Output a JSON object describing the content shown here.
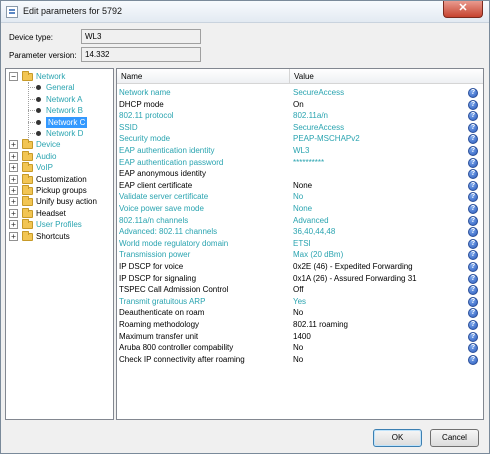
{
  "window": {
    "title": "Edit parameters for 5792",
    "close_symbol": "✕"
  },
  "device": {
    "type_label": "Device type:",
    "type_value": "WL3",
    "version_label": "Parameter version:",
    "version_value": "14.332"
  },
  "tree": {
    "items": [
      {
        "label": "Network",
        "level": 0,
        "expander": "−",
        "teal": true
      },
      {
        "label": "General",
        "level": 1,
        "teal": true
      },
      {
        "label": "Network A",
        "level": 1,
        "teal": true
      },
      {
        "label": "Network B",
        "level": 1,
        "teal": true
      },
      {
        "label": "Network C",
        "level": 1,
        "teal": true,
        "selected": true
      },
      {
        "label": "Network D",
        "level": 1,
        "teal": true
      },
      {
        "label": "Device",
        "level": 0,
        "expander": "+",
        "teal": true
      },
      {
        "label": "Audio",
        "level": 0,
        "expander": "+",
        "teal": true
      },
      {
        "label": "VoIP",
        "level": 0,
        "expander": "+",
        "teal": true
      },
      {
        "label": "Customization",
        "level": 0,
        "expander": "+",
        "teal": false
      },
      {
        "label": "Pickup groups",
        "level": 0,
        "expander": "+",
        "teal": false
      },
      {
        "label": "Unify busy action",
        "level": 0,
        "expander": "+",
        "teal": false
      },
      {
        "label": "Headset",
        "level": 0,
        "expander": "+",
        "teal": false
      },
      {
        "label": "User Profiles",
        "level": 0,
        "expander": "+",
        "teal": true
      },
      {
        "label": "Shortcuts",
        "level": 0,
        "expander": "+",
        "teal": false
      }
    ]
  },
  "grid": {
    "name_header": "Name",
    "value_header": "Value",
    "help_symbol": "?",
    "rows": [
      {
        "name": "Network name",
        "value": "SecureAccess",
        "teal": true
      },
      {
        "name": "DHCP mode",
        "value": "On",
        "teal": false
      },
      {
        "name": "802.11 protocol",
        "value": "802.11a/n",
        "teal": true
      },
      {
        "name": "SSID",
        "value": "SecureAccess",
        "teal": true
      },
      {
        "name": "Security mode",
        "value": "PEAP-MSCHAPv2",
        "teal": true
      },
      {
        "name": "EAP authentication identity",
        "value": "WL3",
        "teal": true
      },
      {
        "name": "EAP authentication password",
        "value": "**********",
        "teal": true
      },
      {
        "name": "EAP anonymous identity",
        "value": "",
        "teal": false
      },
      {
        "name": "EAP client certificate",
        "value": "None",
        "teal": false
      },
      {
        "name": "Validate server certificate",
        "value": "No",
        "teal": true
      },
      {
        "name": "Voice power save mode",
        "value": "None",
        "teal": true
      },
      {
        "name": "802.11a/n channels",
        "value": "Advanced",
        "teal": true
      },
      {
        "name": "Advanced: 802.11 channels",
        "value": "36,40,44,48",
        "teal": true
      },
      {
        "name": "World mode regulatory domain",
        "value": "ETSI",
        "teal": true
      },
      {
        "name": "Transmission power",
        "value": "Max (20 dBm)",
        "teal": true
      },
      {
        "name": "IP DSCP for voice",
        "value": "0x2E (46) - Expedited Forwarding",
        "teal": false
      },
      {
        "name": "IP DSCP for signaling",
        "value": "0x1A (26) - Assured Forwarding 31",
        "teal": false
      },
      {
        "name": "TSPEC Call Admission Control",
        "value": "Off",
        "teal": false
      },
      {
        "name": "Transmit gratuitous ARP",
        "value": "Yes",
        "teal": true
      },
      {
        "name": "Deauthenticate on roam",
        "value": "No",
        "teal": false
      },
      {
        "name": "Roaming methodology",
        "value": "802.11 roaming",
        "teal": false
      },
      {
        "name": "Maximum transfer unit",
        "value": "1400",
        "teal": false
      },
      {
        "name": "Aruba 800 controller compability",
        "value": "No",
        "teal": false
      },
      {
        "name": "Check IP connectivity after roaming",
        "value": "No",
        "teal": false
      }
    ]
  },
  "buttons": {
    "ok": "OK",
    "cancel": "Cancel"
  },
  "colors": {
    "teal_text": "#2aa4b0",
    "selection": "#3399ff",
    "help_icon": "#2f5fbf",
    "folder": "#f2c553"
  }
}
